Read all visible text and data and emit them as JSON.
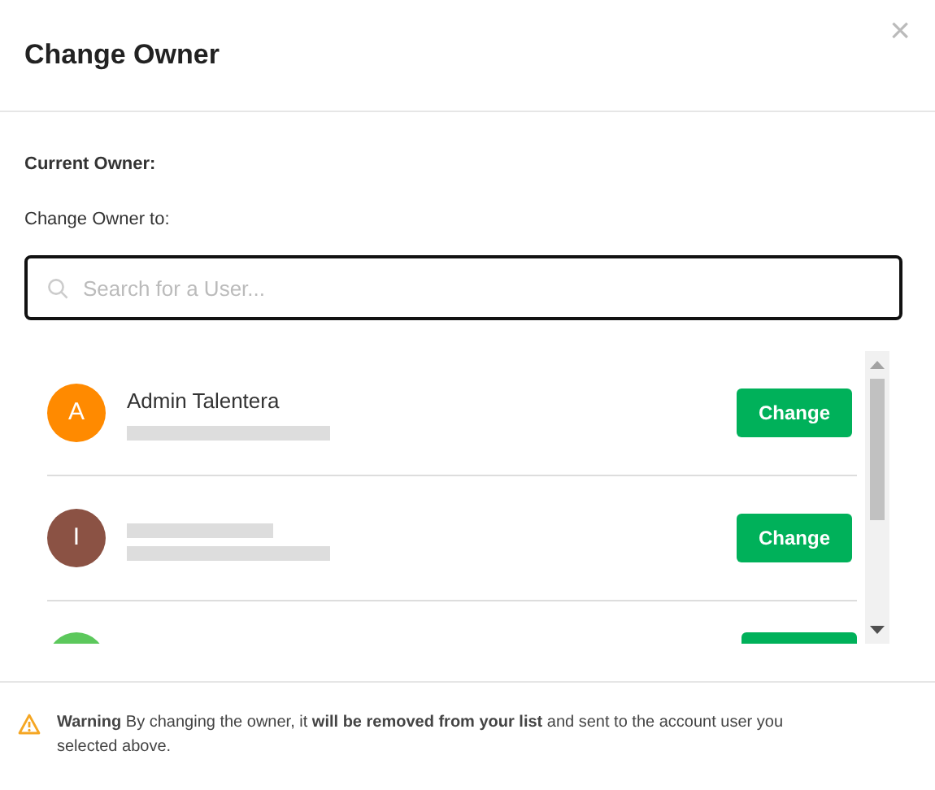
{
  "dialog": {
    "title": "Change Owner",
    "close": "×"
  },
  "current_owner_label": "Current Owner:",
  "change_to_label": "Change Owner to:",
  "search": {
    "placeholder": "Search for a User..."
  },
  "users": [
    {
      "kind": "full",
      "initial": "A",
      "color": "#ff8a00",
      "name": "Admin Talentera",
      "blurred": [
        {
          "kind": "long"
        }
      ],
      "button": "Change"
    },
    {
      "kind": "full",
      "initial": "I",
      "color": "#8b5244",
      "blurred": [
        {
          "kind": "short"
        },
        {
          "kind": "long"
        }
      ],
      "button": "Change"
    },
    {
      "kind": "partial",
      "color": "#5cc85c"
    }
  ],
  "warning": {
    "text": "**Warning** By changing the owner, it **will be removed from your list** and sent to the account user you selected above."
  }
}
